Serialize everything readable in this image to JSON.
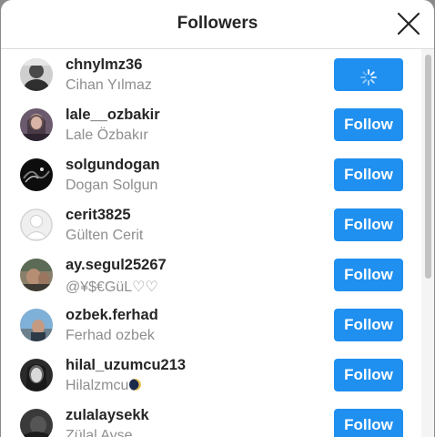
{
  "dialog": {
    "title": "Followers",
    "close_icon": "close-icon"
  },
  "followers": [
    {
      "username": "chnylmz36",
      "fullname": "Cihan Yılmaz",
      "button": "",
      "loading": true
    },
    {
      "username": "lale__ozbakir",
      "fullname": "Lale Özbakır",
      "button": "Follow"
    },
    {
      "username": "solgundogan",
      "fullname": "Dogan Solgun",
      "button": "Follow"
    },
    {
      "username": "cerit3825",
      "fullname": "Gülten Cerit",
      "button": "Follow"
    },
    {
      "username": "ay.segul25267",
      "fullname": "@¥$€GüL♡♡",
      "button": "Follow"
    },
    {
      "username": "ozbek.ferhad",
      "fullname": "Ferhad ozbek",
      "button": "Follow"
    },
    {
      "username": "hilal_uzumcu213",
      "fullname": "Hilalzmcu",
      "button": "Follow",
      "emoji": "moon-icon"
    },
    {
      "username": "zulalaysekk",
      "fullname": "Zülal Ayse",
      "button": "Follow"
    }
  ],
  "colors": {
    "follow_button": "#1f8ff0",
    "username": "#262626",
    "fullname": "#8e8e8e"
  }
}
